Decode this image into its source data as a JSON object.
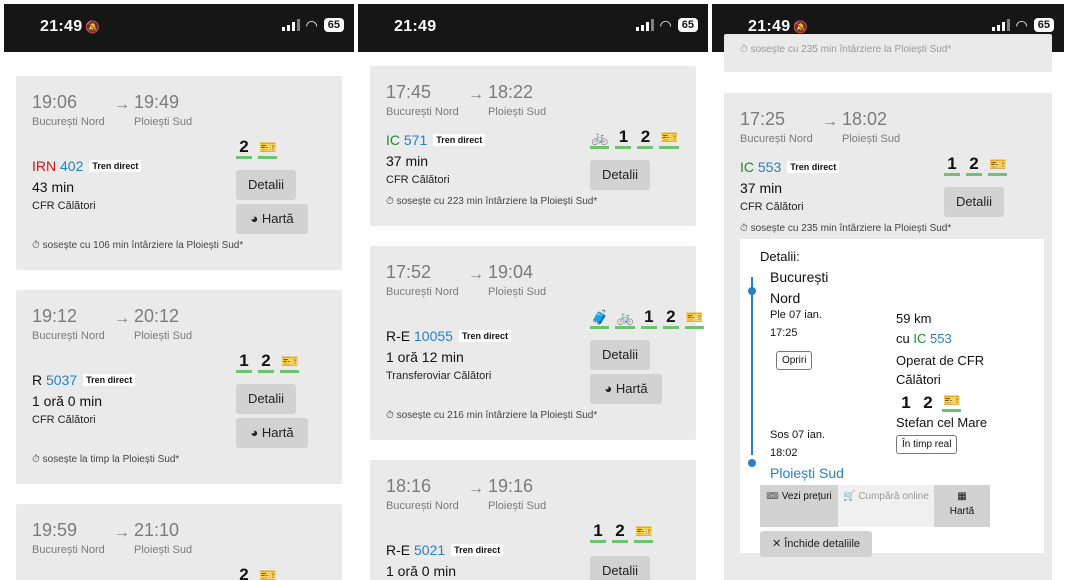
{
  "status": {
    "time": "21:49",
    "battery": "65",
    "bell_icon": "bell-off-icon",
    "signal_icon": "signal-icon",
    "wifi_icon": "wifi-icon"
  },
  "screen1": {
    "trains": [
      {
        "dep": "19:06",
        "arr": "19:49",
        "from": "București Nord",
        "to": "Ploiești Sud",
        "category": "IRN",
        "number": "402",
        "direct": "Tren direct",
        "duration": "43 min",
        "operator": "CFR Călători",
        "classes": [
          "2"
        ],
        "details": "Detalii",
        "map": "Hartă",
        "delay": "sosește cu 106 min întârziere la Ploiești Sud*"
      },
      {
        "dep": "19:12",
        "arr": "20:12",
        "from": "București Nord",
        "to": "Ploiești Sud",
        "category": "R",
        "number": "5037",
        "direct": "Tren direct",
        "duration": "1 oră 0 min",
        "operator": "CFR Călători",
        "classes": [
          "1",
          "2"
        ],
        "details": "Detalii",
        "map": "Hartă",
        "delay": "sosește la timp la Ploiești Sud*"
      },
      {
        "dep": "19:59",
        "arr": "21:10",
        "from": "București Nord",
        "to": "Ploiești Sud",
        "classes": [
          "2"
        ]
      }
    ]
  },
  "screen2": {
    "trains": [
      {
        "dep": "17:45",
        "arr": "18:22",
        "from": "București Nord",
        "to": "Ploiești Sud",
        "category": "IC",
        "number": "571",
        "direct": "Tren direct",
        "duration": "37 min",
        "operator": "CFR Călători",
        "classes": [
          "1",
          "2"
        ],
        "details": "Detalii",
        "delay": "sosește cu 223 min întârziere la Ploiești Sud*"
      },
      {
        "dep": "17:52",
        "arr": "19:04",
        "from": "București Nord",
        "to": "Ploiești Sud",
        "category": "R-E",
        "number": "10055",
        "direct": "Tren direct",
        "duration": "1 oră 12 min",
        "operator": "Transferoviar Călători",
        "classes": [
          "1",
          "2"
        ],
        "details": "Detalii",
        "map": "Hartă",
        "delay": "sosește cu 216 min întârziere la Ploiești Sud*"
      },
      {
        "dep": "18:16",
        "arr": "19:16",
        "from": "București Nord",
        "to": "Ploiești Sud",
        "category": "R-E",
        "number": "5021",
        "direct": "Tren direct",
        "duration": "1 oră 0 min",
        "classes": [
          "1",
          "2"
        ],
        "details": "Detalii"
      }
    ]
  },
  "screen3": {
    "top_partial": "sosește cu 235 min întârziere la Ploiești Sud*",
    "train": {
      "dep": "17:25",
      "arr": "18:02",
      "from": "București Nord",
      "to": "Ploiești Sud",
      "category": "IC",
      "number": "553",
      "direct": "Tren direct",
      "duration": "37 min",
      "operator": "CFR Călători",
      "classes": [
        "1",
        "2"
      ],
      "details": "Detalii",
      "delay": "sosește cu 235 min întârziere la Ploiești Sud*"
    },
    "detail": {
      "heading": "Detalii:",
      "from_station": "București Nord",
      "dep_date": "Ple 07 ian.",
      "dep_time": "17:25",
      "stops": "Opriri",
      "distance": "59 km",
      "with_label": "cu",
      "train_cat": "IC",
      "train_num": "553",
      "operated": "Operat de CFR Călători",
      "classes": [
        "1",
        "2"
      ],
      "train_name": "Stefan cel Mare",
      "realtime": "În timp real",
      "arr_date": "Sos 07 ian.",
      "arr_time": "18:02",
      "to_station": "Ploiești Sud",
      "prices": "Vezi prețuri",
      "buy": "Cumpără online",
      "map": "Hartă",
      "close": "Închide detaliile"
    }
  }
}
